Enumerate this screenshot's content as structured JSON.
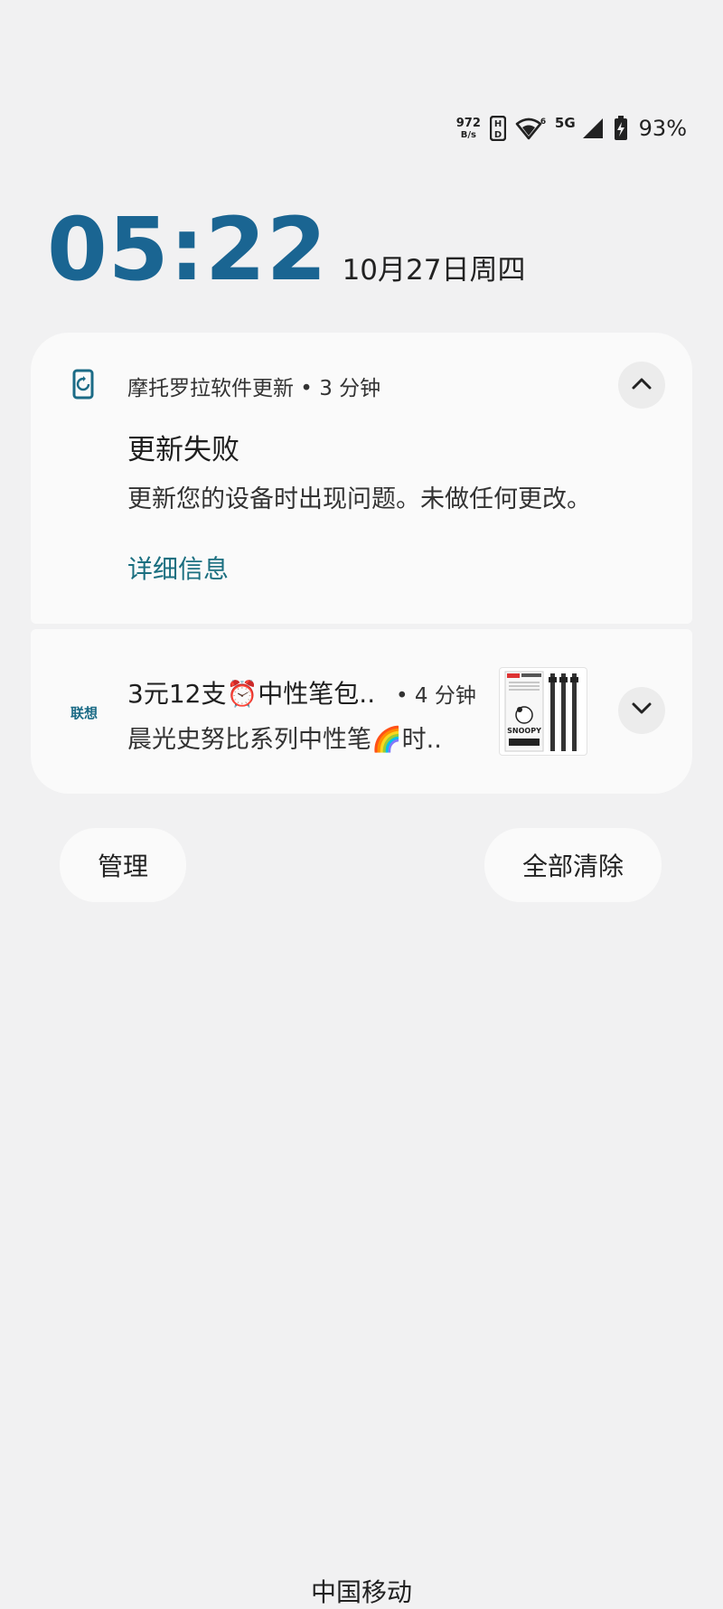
{
  "status_bar": {
    "net_speed_value": "972",
    "net_speed_unit": "B/s",
    "hd_icon": "hd-badge-icon",
    "wifi_icon": "wifi-6-icon",
    "network_type": "5G",
    "signal_icon": "cell-signal-icon",
    "battery_icon": "battery-charging-icon",
    "battery_percent": "93%"
  },
  "clock": {
    "time": "05:22",
    "date": "10月27日周四"
  },
  "notifications": [
    {
      "app_icon": "phone-update-icon",
      "app_header": "摩托罗拉软件更新 • 3 分钟",
      "title": "更新失败",
      "body": "更新您的设备时出现问题。未做任何更改。",
      "action": "详细信息",
      "toggle_icon": "chevron-up-icon"
    },
    {
      "app_logo": "联想",
      "title": "3元12支⏰中性笔包..",
      "time": "• 4 分钟",
      "body": "晨光史努比系列中性笔🌈时..",
      "thumbnail_brand": "SNOOPY",
      "toggle_icon": "chevron-down-icon"
    }
  ],
  "buttons": {
    "manage": "管理",
    "clear_all": "全部清除"
  },
  "carrier": "中国移动",
  "colors": {
    "clock": "#1a6592",
    "action_link": "#1b6f80",
    "background": "#f1f1f2",
    "card": "#fafafa"
  }
}
